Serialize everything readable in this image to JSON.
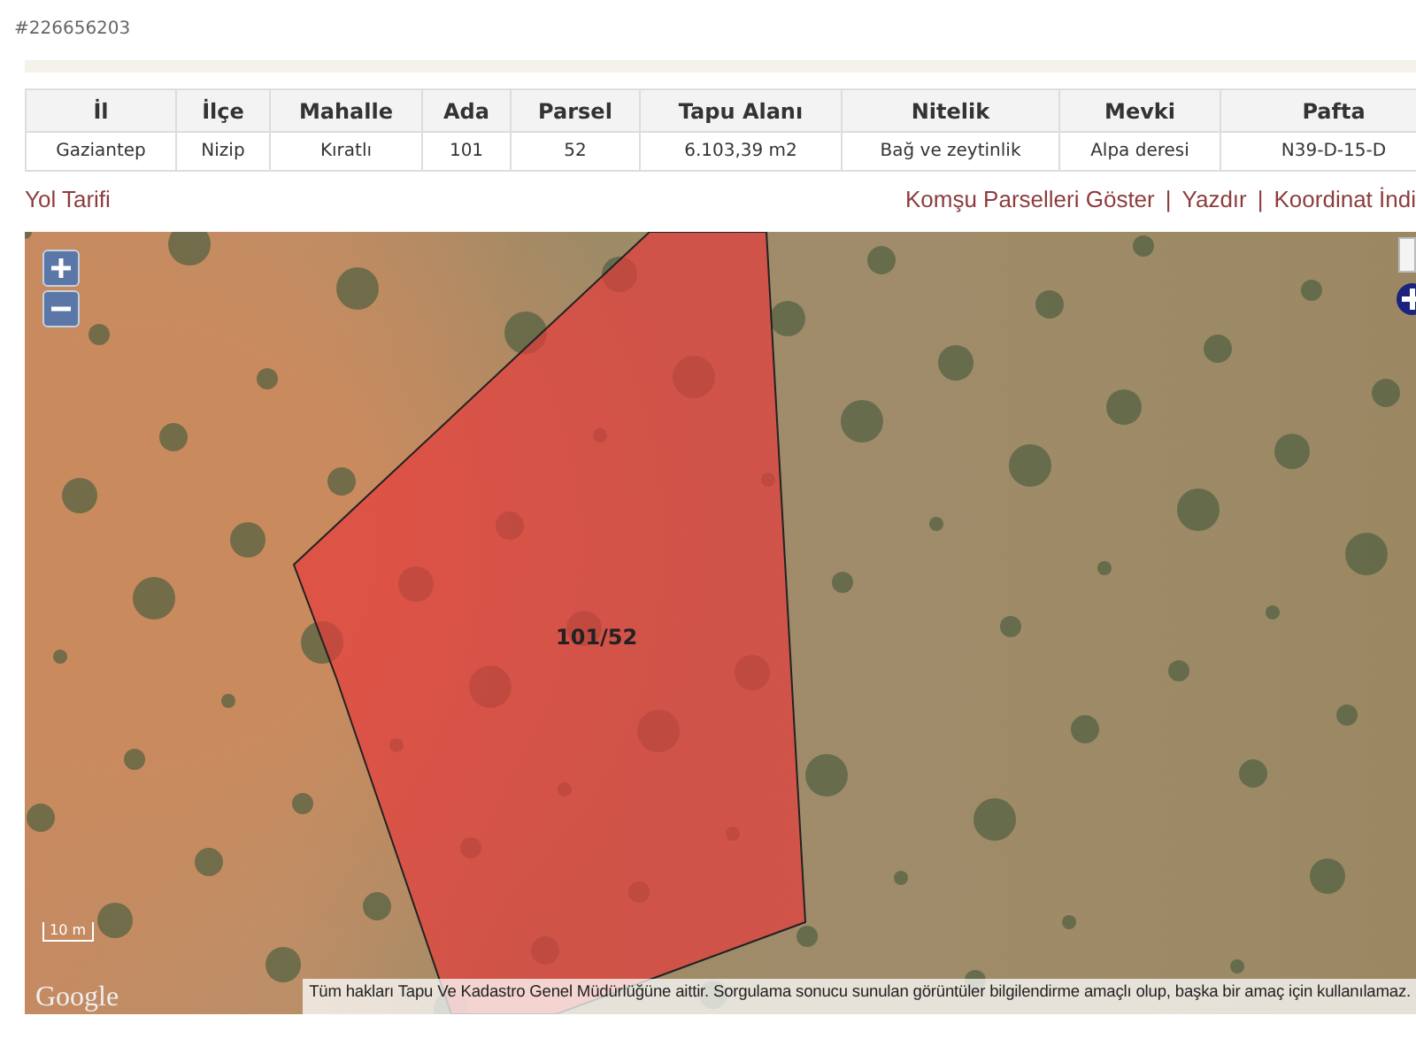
{
  "record_id": "#226656203",
  "table": {
    "columns": [
      "İl",
      "İlçe",
      "Mahalle",
      "Ada",
      "Parsel",
      "Tapu Alanı",
      "Nitelik",
      "Mevki",
      "Pafta"
    ],
    "rows": [
      [
        "Gaziantep",
        "Nizip",
        "Kıratlı",
        "101",
        "52",
        "6.103,39 m2",
        "Bağ ve zeytinlik",
        "Alpa deresi",
        "N39-D-15-D"
      ]
    ]
  },
  "links": {
    "left": "Yol Tarifi",
    "right": [
      {
        "label": "Komşu Parselleri Göster",
        "separator": "|"
      },
      {
        "label": "Yazdır",
        "separator": "|"
      },
      {
        "label": "Koordinat İndi"
      }
    ]
  },
  "map": {
    "parcel_label": "101/52",
    "scale": "10 m",
    "logo": "Google",
    "disclaimer": "Tüm hakları Tapu Ve Kadastro Genel Müdürlüğüne aittir. Sorgulama sonucu sunulan görüntüler bilgilendirme amaçlı olup, başka bir amaç için kullanılamaz."
  }
}
